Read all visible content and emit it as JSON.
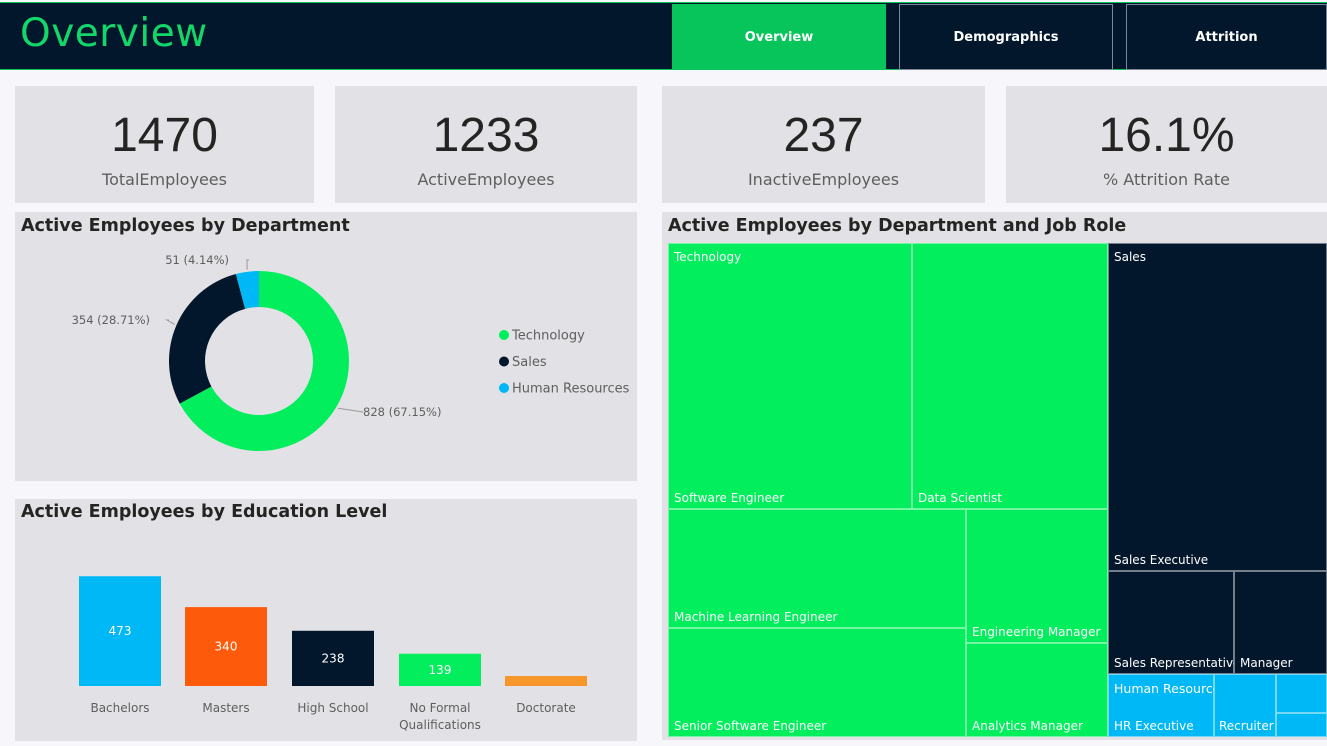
{
  "header": {
    "title": "Overview",
    "tabs": [
      {
        "label": "Overview",
        "active": true
      },
      {
        "label": "Demographics",
        "active": false
      },
      {
        "label": "Attrition",
        "active": false
      }
    ]
  },
  "kpis": [
    {
      "value": "1470",
      "label": "TotalEmployees"
    },
    {
      "value": "1233",
      "label": "ActiveEmployees"
    },
    {
      "value": "237",
      "label": "InactiveEmployees"
    },
    {
      "value": "16.1%",
      "label": "% Attrition Rate"
    }
  ],
  "colors": {
    "technology": "#02ee5c",
    "sales": "#03172c",
    "human_resources": "#00b8f5",
    "masters": "#fe5a0b",
    "doctorate": "#f7972b",
    "accent": "#07c45b"
  },
  "chart_data": [
    {
      "type": "pie",
      "title": "Active Employees by Department",
      "donut": true,
      "legend_position": "right",
      "slices": [
        {
          "name": "Technology",
          "value": 828,
          "label": "828 (67.15%)",
          "color": "#02ee5c"
        },
        {
          "name": "Sales",
          "value": 354,
          "label": "354 (28.71%)",
          "color": "#03172c"
        },
        {
          "name": "Human Resources",
          "value": 51,
          "label": "51 (4.14%)",
          "color": "#00b8f5"
        }
      ]
    },
    {
      "type": "bar",
      "title": "Active Employees by Education Level",
      "categories": [
        "Bachelors",
        "Masters",
        "High School",
        "No Formal Qualifications",
        "Doctorate"
      ],
      "values": [
        473,
        340,
        238,
        139,
        43
      ],
      "data_labels": [
        "473",
        "340",
        "238",
        "139",
        ""
      ],
      "colors": [
        "#00b8f5",
        "#fe5a0b",
        "#03172c",
        "#02ee5c",
        "#f7972b"
      ],
      "ylim": [
        0,
        500
      ]
    },
    {
      "type": "treemap",
      "title": "Active Employees by Department and Job Role",
      "groups": [
        {
          "name": "Technology",
          "color": "#02ee5c",
          "roles": [
            "Software Engineer",
            "Data Scientist",
            "Machine Learning Engineer",
            "Engineering Manager",
            "Senior Software Engineer",
            "Analytics Manager"
          ]
        },
        {
          "name": "Sales",
          "color": "#03172c",
          "roles": [
            "Sales Executive",
            "Sales Representative",
            "Manager"
          ]
        },
        {
          "name": "Human Resources",
          "color": "#00b8f5",
          "roles": [
            "HR Executive",
            "Recruiter"
          ]
        }
      ]
    }
  ]
}
